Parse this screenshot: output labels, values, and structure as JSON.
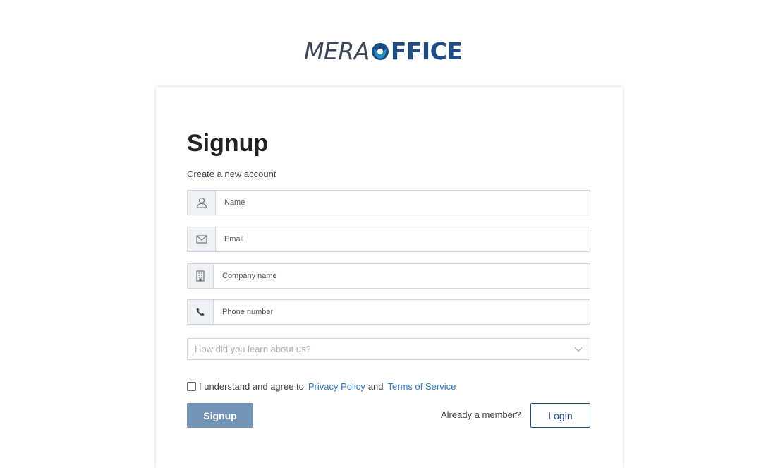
{
  "brand": {
    "part1": "MERA",
    "part2": "FFICE",
    "primary_color": "#1f4c82",
    "accent_color": "#2a8fc0"
  },
  "form": {
    "title": "Signup",
    "subtitle": "Create a new account",
    "fields": [
      {
        "placeholder": "Name",
        "icon": "user-icon"
      },
      {
        "placeholder": "Email",
        "icon": "envelope-icon"
      },
      {
        "placeholder": "Company name",
        "icon": "building-icon"
      },
      {
        "placeholder": "Phone number",
        "icon": "phone-icon"
      }
    ],
    "referral_select": {
      "placeholder": "How did you learn about us?",
      "icon": "chevron-down-icon"
    },
    "agree": {
      "prefix": "I understand and agree to",
      "privacy": "Privacy Policy",
      "conjunction": "and",
      "terms": "Terms of Service",
      "checked": false
    },
    "signup_label": "Signup",
    "member_text": "Already a member?",
    "login_label": "Login",
    "signup_button_color": "#7194b7"
  }
}
